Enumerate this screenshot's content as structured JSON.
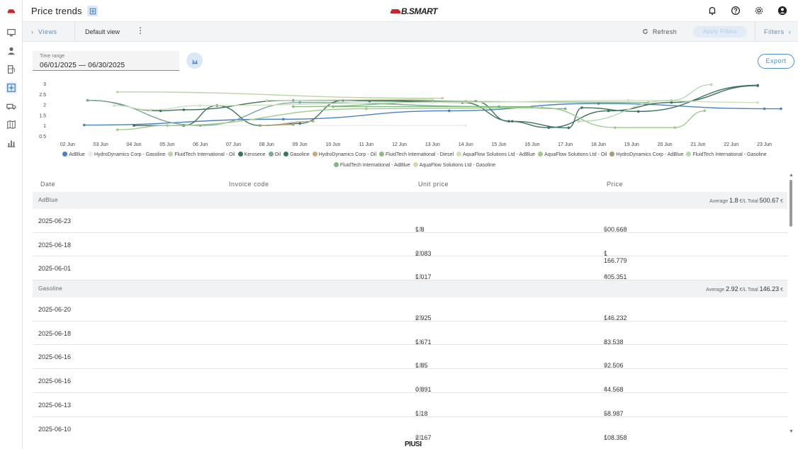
{
  "header": {
    "title": "Price trends",
    "logo_text": "B.SMART",
    "icons": [
      "bell-icon",
      "help-icon",
      "gear-icon",
      "account-icon"
    ]
  },
  "sidebar": {
    "items": [
      "truck-icon",
      "monitor-icon",
      "user-icon",
      "fuel-pump-icon",
      "price-trends-icon",
      "vehicle-icon",
      "map-icon",
      "chart-icon"
    ],
    "active": "price-trends-icon",
    "brand_color": "#c9252c"
  },
  "toolbar": {
    "views_label": "Views",
    "default_view": "Default view",
    "refresh_label": "Refresh",
    "apply_label": "Apply Filters",
    "filters_label": "Filters"
  },
  "time_range": {
    "label": "Time range",
    "value": "06/01/2025 — 06/30/2025"
  },
  "export_label": "Export",
  "chart_data": {
    "type": "line",
    "x": [
      "02 Jun",
      "03 Jun",
      "04 Jun",
      "05 Jun",
      "06 Jun",
      "07 Jun",
      "08 Jun",
      "09 Jun",
      "10 Jun",
      "11 Jun",
      "12 Jun",
      "13 Jun",
      "14 Jun",
      "15 Jun",
      "16 Jun",
      "17 Jun",
      "18 Jun",
      "19 Jun",
      "20 Jun",
      "21 Jun",
      "22 Jun",
      "23 Jun"
    ],
    "ylim": [
      0.5,
      3
    ],
    "yticks": [
      "0.5",
      "1",
      "1.5",
      "2",
      "2.5",
      "3"
    ],
    "grid": false,
    "legend_position": "bottom",
    "series": [
      {
        "name": "AdBlue",
        "color": "#4a7fc4",
        "points": [
          [
            1.5,
            1.02
          ],
          [
            7.5,
            1.3
          ],
          [
            12.5,
            1.7
          ],
          [
            17,
            2.05
          ],
          [
            22,
            1.8
          ],
          [
            22.5,
            1.8
          ]
        ]
      },
      {
        "name": "HydroDynamics Corp - Gasoline",
        "color": "#e8eee7",
        "points": [
          [
            3.5,
            1.0
          ],
          [
            8,
            1.0
          ],
          [
            13,
            1.0
          ]
        ]
      },
      {
        "name": "FluidTech International - Oil",
        "color": "#bcd3a9",
        "points": [
          [
            2.5,
            2.6
          ],
          [
            12.3,
            2.3
          ]
        ]
      },
      {
        "name": "Kerosene",
        "color": "#3e6f5a",
        "points": [
          [
            1.6,
            2.2
          ],
          [
            3.8,
            1.7
          ],
          [
            4.5,
            1.75
          ],
          [
            7.8,
            2.2
          ],
          [
            10.3,
            2.2
          ],
          [
            13.3,
            2.15
          ],
          [
            14.3,
            1.2
          ],
          [
            15.5,
            0.9
          ],
          [
            17.3,
            1.7
          ],
          [
            19.2,
            2.1
          ],
          [
            21.8,
            2.9
          ]
        ]
      },
      {
        "name": "Oil",
        "color": "#7aa7a0",
        "points": [
          [
            1.6,
            2.2
          ],
          [
            5,
            1.0
          ],
          [
            8,
            2.1
          ],
          [
            14,
            1.9
          ],
          [
            16,
            1.8
          ]
        ]
      },
      {
        "name": "Gasoline",
        "color": "#3e7561",
        "points": [
          [
            3,
            1.0
          ],
          [
            4.5,
            1.0
          ],
          [
            5.5,
            1.95
          ],
          [
            6.8,
            1.0
          ],
          [
            8,
            1.1
          ],
          [
            9.3,
            2.2
          ],
          [
            10.1,
            2.17
          ],
          [
            12.9,
            2.1
          ],
          [
            14.4,
            1.2
          ],
          [
            16.1,
            0.89
          ],
          [
            16.5,
            1.85
          ],
          [
            18.2,
            1.67
          ],
          [
            21.8,
            2.92
          ]
        ]
      },
      {
        "name": "HydroDynamics Corp - Oil",
        "color": "#c8a785",
        "points": [
          [
            6.8,
            1.0
          ],
          [
            8.4,
            1.2
          ]
        ]
      },
      {
        "name": "FluidTech International - Diesel",
        "color": "#8dbb84",
        "points": [
          [
            7.8,
            1.9
          ],
          [
            13,
            2.15
          ],
          [
            18.5,
            2.1
          ]
        ]
      },
      {
        "name": "AquaFlow Solutions Ltd - AdBlue",
        "color": "#cfe0bf",
        "points": [
          [
            2.4,
            1.95
          ],
          [
            3.5,
            1.75
          ],
          [
            5,
            1.95
          ],
          [
            12,
            2.1
          ],
          [
            17.9,
            2.2
          ],
          [
            21.8,
            2.1
          ]
        ]
      },
      {
        "name": "AquaFlow Solutions Ltd - Oil",
        "color": "#9fca8c",
        "points": [
          [
            2.5,
            0.8
          ],
          [
            4,
            1.0
          ],
          [
            10,
            1.8
          ],
          [
            15.3,
            1.85
          ],
          [
            17.5,
            0.9
          ],
          [
            19.3,
            0.9
          ],
          [
            20.2,
            1.7
          ]
        ]
      },
      {
        "name": "HydroDynamics Corp - AdBlue",
        "color": "#a89a7a",
        "points": [
          [
            6.8,
            1.0
          ],
          [
            7.8,
            1.05
          ]
        ]
      },
      {
        "name": "FluidTech International - Gasoline",
        "color": "#b7d9b1",
        "points": [
          [
            16.4,
            1.2
          ],
          [
            19.2,
            2.2
          ],
          [
            20.4,
            2.95
          ]
        ]
      },
      {
        "name": "FluidTech International - AdBlue",
        "color": "#7eb880",
        "points": [
          [
            9,
            1.9
          ],
          [
            15,
            1.9
          ]
        ]
      },
      {
        "name": "AquaFlow Solutions Ltd - Gasoline",
        "color": "#d8d6b0",
        "points": [
          [
            7,
            2.2
          ],
          [
            12,
            2.25
          ]
        ]
      }
    ]
  },
  "table": {
    "columns": [
      "Date",
      "Invoice code",
      "Unit price",
      "Price"
    ],
    "groups": [
      {
        "name": "AdBlue",
        "average_label": "Average",
        "average": "1.8",
        "average_unit": "€/L",
        "total_label": "Total",
        "total": "500.67",
        "total_unit": "€",
        "rows": [
          {
            "date": "2025-06-23",
            "invoice": "",
            "unit_price": "1.8",
            "unit_unit": "€/L",
            "price": "500.668",
            "price_unit": "€"
          },
          {
            "date": "2025-06-18",
            "invoice": "",
            "unit_price": "2.083",
            "unit_unit": "€/L",
            "price": "1 166.779",
            "price_unit": "€"
          },
          {
            "date": "2025-06-01",
            "invoice": "",
            "unit_price": "1.017",
            "unit_unit": "€/L",
            "price": "405.351",
            "price_unit": "€"
          }
        ]
      },
      {
        "name": "Gasoline",
        "average_label": "Average",
        "average": "2.92",
        "average_unit": "€/L",
        "total_label": "Total",
        "total": "146.23",
        "total_unit": "€",
        "rows": [
          {
            "date": "2025-06-20",
            "invoice": "",
            "unit_price": "2.925",
            "unit_unit": "€/L",
            "price": "146.232",
            "price_unit": "€"
          },
          {
            "date": "2025-06-18",
            "invoice": "",
            "unit_price": "1.671",
            "unit_unit": "€/L",
            "price": "83.538",
            "price_unit": "€"
          },
          {
            "date": "2025-06-16",
            "invoice": "",
            "unit_price": "1.85",
            "unit_unit": "€/L",
            "price": "92.506",
            "price_unit": "€"
          },
          {
            "date": "2025-06-16",
            "invoice": "",
            "unit_price": "0.891",
            "unit_unit": "€/L",
            "price": "44.568",
            "price_unit": "€"
          },
          {
            "date": "2025-06-13",
            "invoice": "",
            "unit_price": "1.18",
            "unit_unit": "€/L",
            "price": "58.987",
            "price_unit": "€"
          },
          {
            "date": "2025-06-10",
            "invoice": "",
            "unit_price": "2.167",
            "unit_unit": "€/L",
            "price": "108.358",
            "price_unit": "€"
          }
        ]
      }
    ]
  },
  "footer": {
    "logo_text": "PIUSI"
  }
}
